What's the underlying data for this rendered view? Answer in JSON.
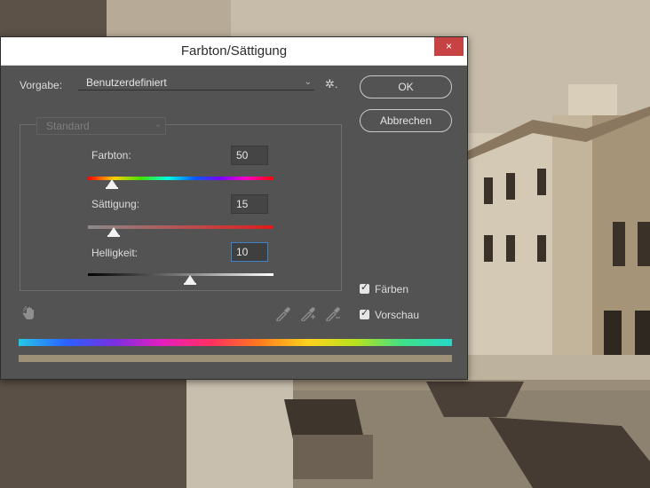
{
  "dialog": {
    "title": "Farbton/Sättigung",
    "close_glyph": "×",
    "preset_label": "Vorgabe:",
    "preset_value": "Benutzerdefiniert",
    "preset_chevron": "⌄",
    "gear_glyph": "✲.",
    "ok_label": "OK",
    "cancel_label": "Abbrechen",
    "channel_value": "Standard",
    "channel_chevron": "⌄"
  },
  "sliders": {
    "hue": {
      "label": "Farbton:",
      "value": "50",
      "level": 0.13
    },
    "saturation": {
      "label": "Sättigung:",
      "value": "15",
      "level": 0.14
    },
    "lightness": {
      "label": "Helligkeit:",
      "value": "10",
      "level": 0.55
    }
  },
  "options": {
    "colorize": {
      "label": "Färben",
      "checked": true
    },
    "preview": {
      "label": "Vorschau",
      "checked": true
    }
  },
  "icons": {
    "hand": "hand-tool-icon",
    "eyedropper": "eyedropper-icon",
    "eyedropper_add": "eyedropper-add-icon",
    "eyedropper_subtract": "eyedropper-subtract-icon",
    "check": "✓"
  },
  "colors": {
    "dialog_bg": "#535353",
    "close_red": "#c74343",
    "focus_blue": "#3d83c9",
    "toned_bar": "#9d9178"
  }
}
